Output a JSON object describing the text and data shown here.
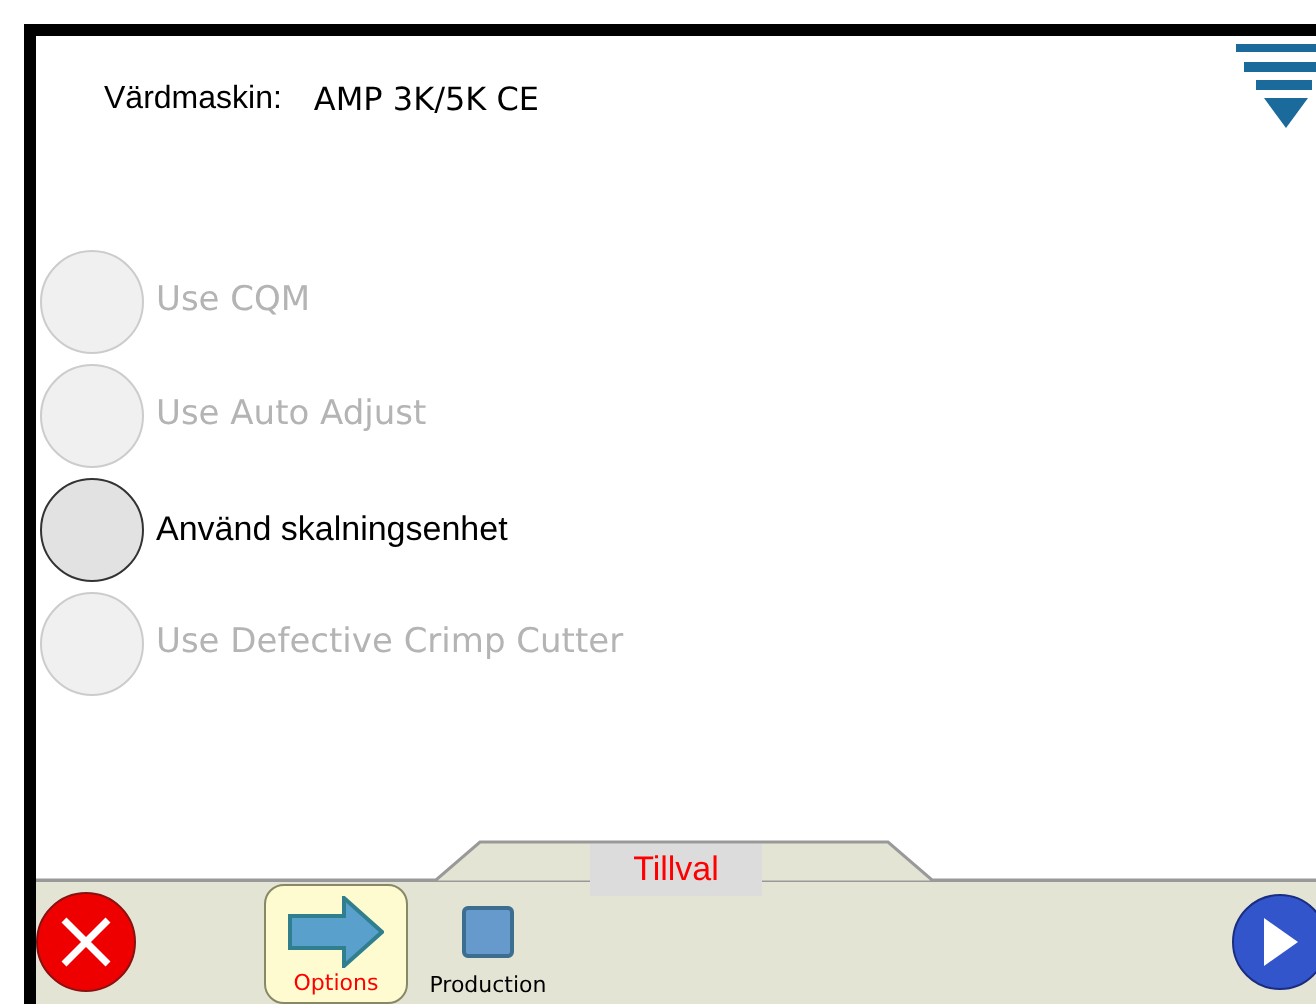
{
  "header": {
    "label": "Värdmaskin:",
    "value": "AMP 3K/5K CE"
  },
  "options": [
    {
      "label": "Use CQM",
      "disabled": true
    },
    {
      "label": "Use Auto Adjust",
      "disabled": true
    },
    {
      "label": "Använd skalningsenhet",
      "disabled": false
    },
    {
      "label": "Use Defective Crimp Cutter",
      "disabled": true
    }
  ],
  "tab": {
    "label": "Tillval"
  },
  "toolbar": {
    "items": [
      {
        "label": "Options",
        "selected": true
      },
      {
        "label": "Production",
        "selected": false
      }
    ]
  }
}
